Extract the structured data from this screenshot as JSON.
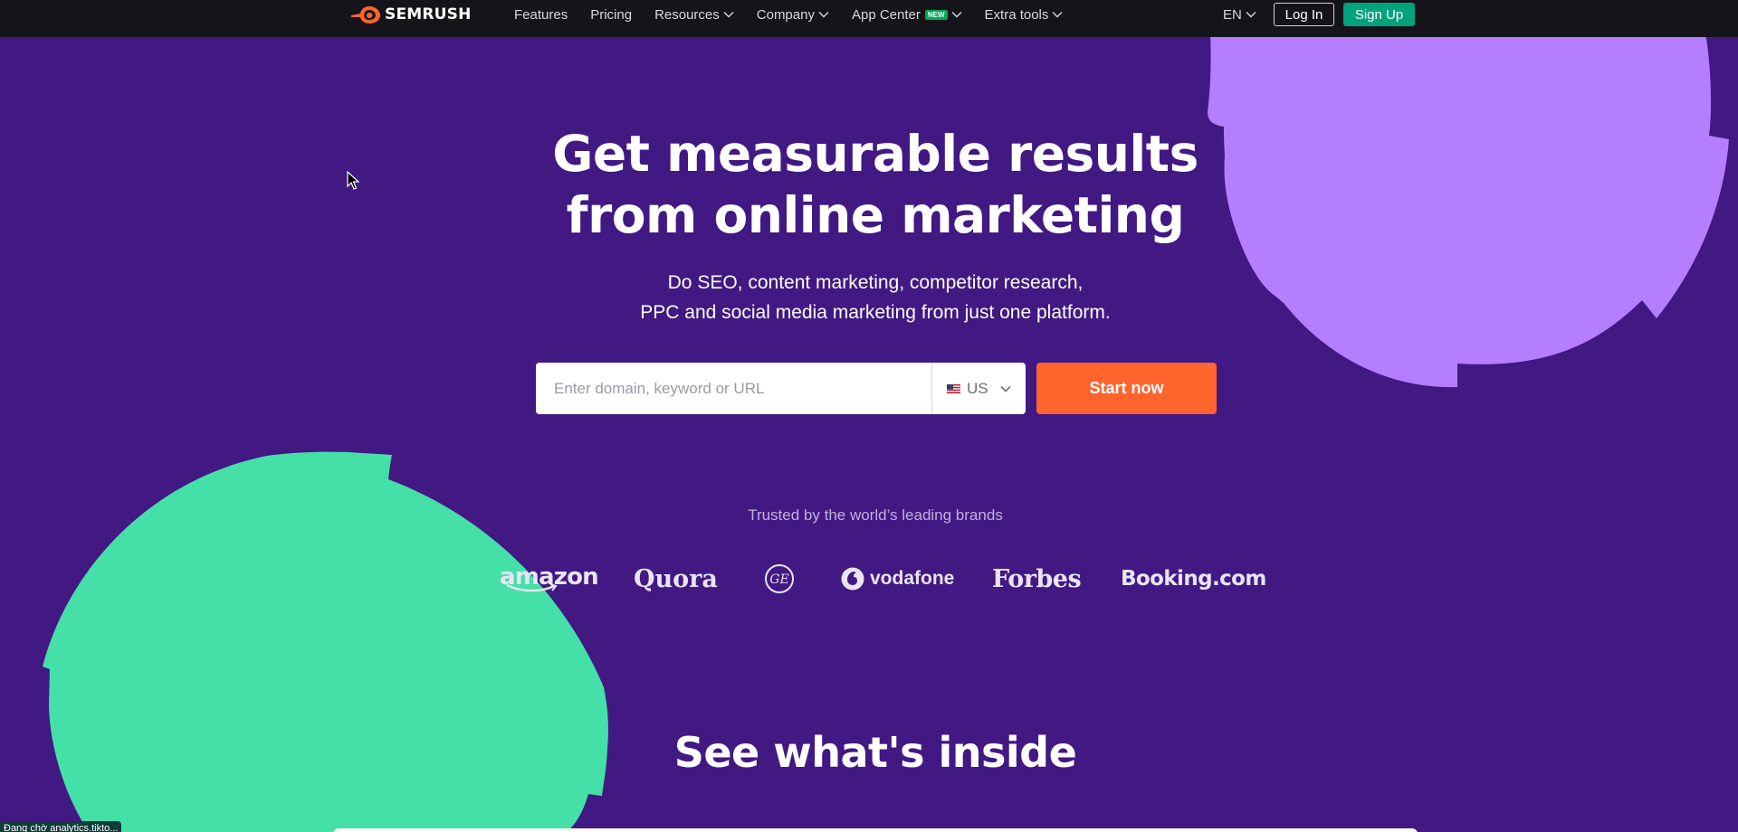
{
  "colors": {
    "page_background": "#421983",
    "topbar_background": "#16141b",
    "accent_orange": "#ff642d",
    "signup_green": "#00a37c",
    "shape_lilac": "#b57eff",
    "shape_mint": "#45e0a8"
  },
  "header": {
    "logo_text": "SEMRUSH",
    "nav": [
      {
        "label": "Features",
        "has_dropdown": false
      },
      {
        "label": "Pricing",
        "has_dropdown": false
      },
      {
        "label": "Resources",
        "has_dropdown": true
      },
      {
        "label": "Company",
        "has_dropdown": true
      },
      {
        "label": "App Center",
        "badge": "NEW",
        "has_dropdown": true
      },
      {
        "label": "Extra tools",
        "has_dropdown": true
      }
    ],
    "language": "EN",
    "login_label": "Log In",
    "signup_label": "Sign Up"
  },
  "hero": {
    "title_line1": "Get measurable results",
    "title_line2": "from online marketing",
    "subtitle_line1": "Do SEO, content marketing, competitor research,",
    "subtitle_line2": "PPC and social media marketing from just one platform.",
    "search": {
      "placeholder": "Enter domain, keyword or URL",
      "value": "",
      "country": "US",
      "country_flag_icon": "us-flag-icon"
    },
    "cta_label": "Start now"
  },
  "brands": {
    "caption": "Trusted by the world’s leading brands",
    "items": [
      "amazon",
      "Quora",
      "GE",
      "vodafone",
      "Forbes",
      "Booking.com"
    ]
  },
  "section": {
    "title": "See what's inside"
  },
  "status_tooltip": "Đang chờ analytics.tikto..."
}
